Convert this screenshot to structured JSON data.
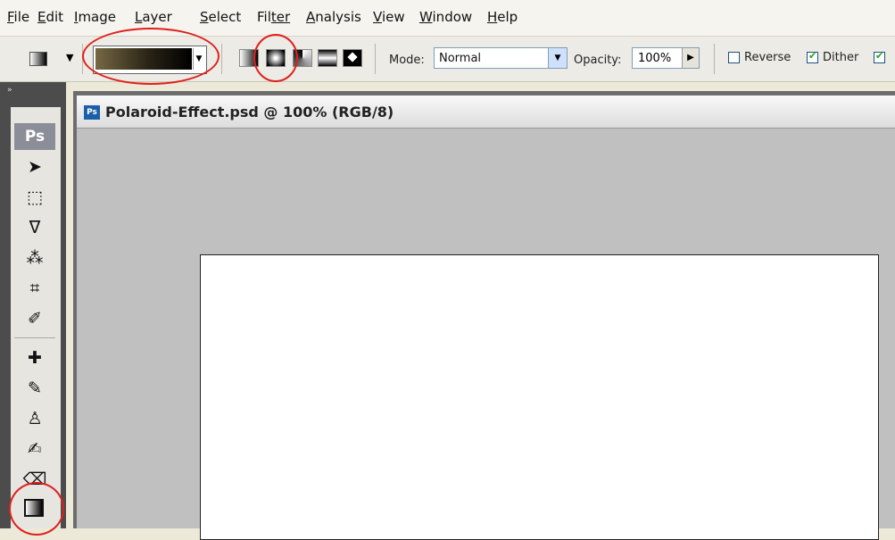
{
  "menu": [
    {
      "label": "File",
      "key": "F",
      "rest": "ile"
    },
    {
      "label": "Edit",
      "key": "E",
      "rest": "dit"
    },
    {
      "label": "Image",
      "key": "I",
      "rest": "mage"
    },
    {
      "label": "Layer",
      "key": "L",
      "rest": "ayer"
    },
    {
      "label": "Select",
      "key": "S",
      "rest": "elect"
    },
    {
      "label": "Filter",
      "key": "Fil",
      "rest": "ter"
    },
    {
      "label": "Analysis",
      "key": "A",
      "rest": "nalysis"
    },
    {
      "label": "View",
      "key": "V",
      "rest": "iew"
    },
    {
      "label": "Window",
      "key": "W",
      "rest": "indow"
    },
    {
      "label": "Help",
      "key": "H",
      "rest": "elp"
    }
  ],
  "options": {
    "mode_label": "Mode:",
    "mode_value": "Normal",
    "opacity_label": "Opacity:",
    "opacity_value": "100%",
    "reverse_label": "Reverse",
    "reverse_checked": false,
    "dither_label": "Dither",
    "dither_checked": true,
    "transparency_checked": true,
    "gradient_type_selected": "radial"
  },
  "tools": {
    "logo": "Ps"
  },
  "document": {
    "title": "Polaroid-Effect.psd @ 100% (RGB/8)",
    "icon_text": "Ps"
  },
  "colors": {
    "annotation": "#e0201c",
    "gradient_dark": "#2a2416",
    "gradient_light": "#766844"
  }
}
